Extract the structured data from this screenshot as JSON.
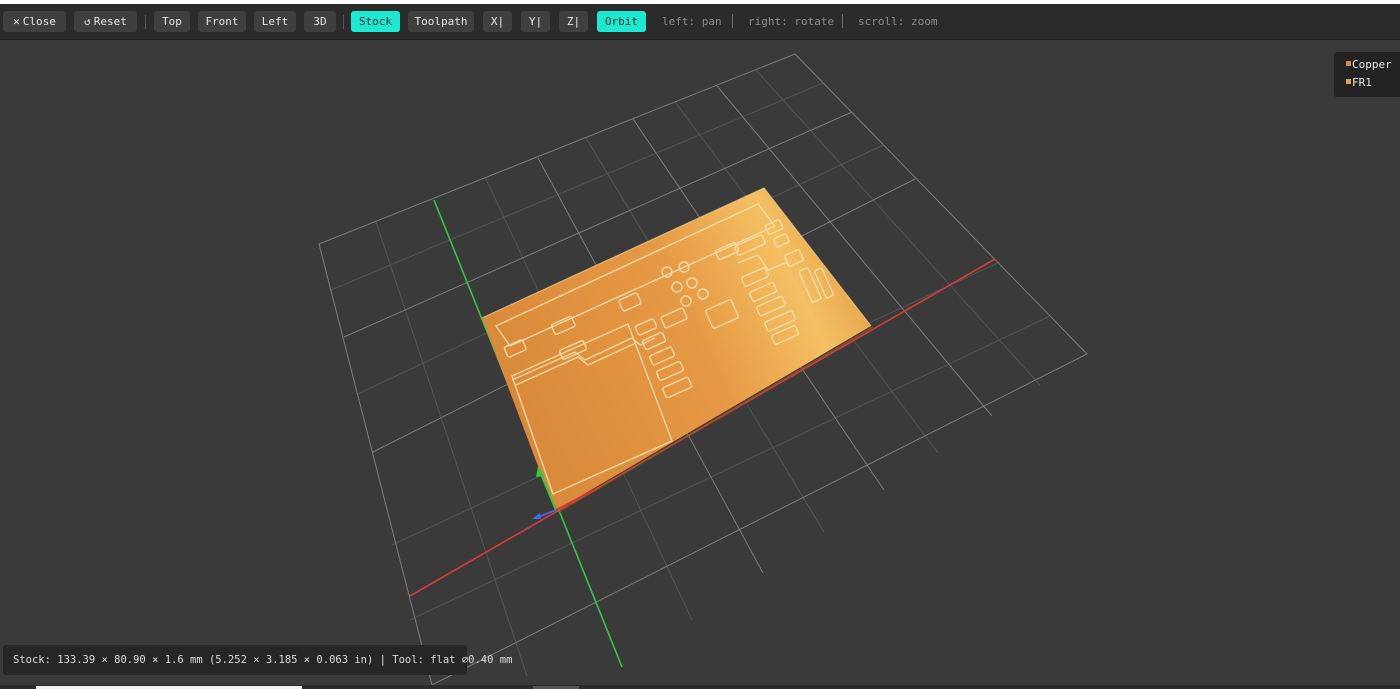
{
  "toolbar": {
    "close": {
      "icon": "close-icon",
      "label": "Close"
    },
    "reset": {
      "icon": "reset-icon",
      "label": "Reset"
    },
    "views": [
      "Top",
      "Front",
      "Left",
      "3D"
    ],
    "modes": {
      "stock": "Stock",
      "toolpath": "Toolpath",
      "orbit": "Orbit"
    },
    "clip_axes": [
      "X",
      "Y",
      "Z"
    ],
    "active": [
      "Stock",
      "Orbit"
    ],
    "hints": [
      "left: pan",
      "right: rotate",
      "scroll: zoom"
    ]
  },
  "legend": [
    {
      "label": "Copper",
      "color": "#e0874a"
    },
    {
      "label": "FR1",
      "color": "#e8a24a"
    }
  ],
  "status": "Stock: 133.39 × 80.90 × 1.6 mm (5.252 × 3.185 × 0.063 in) | Tool: flat ⌀0.40 mm",
  "colors": {
    "accent": "#1de9d3",
    "x_axis": "#d83a3a",
    "y_axis": "#34c640",
    "z_axis": "#3f6fdc",
    "grid": "#8a8a8a",
    "background": "#3a3a3a"
  }
}
